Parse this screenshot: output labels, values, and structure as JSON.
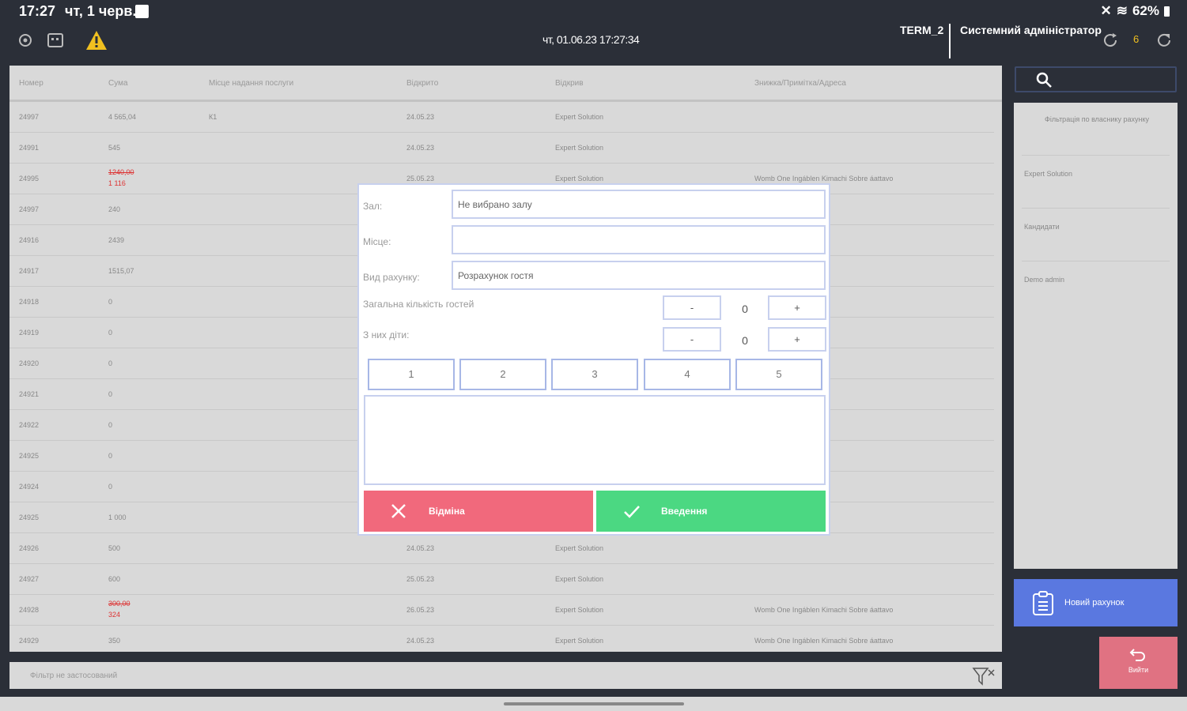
{
  "status_bar": {
    "time": "17:27",
    "date": "чт, 1 черв.",
    "battery": "62%"
  },
  "header": {
    "datetime": "чт, 01.06.23 17:27:34",
    "terminal": "TERM_2",
    "user": "Системний адміністратор",
    "notification_count": "6",
    "warning_color": "#f0c020"
  },
  "table": {
    "headers": [
      "Номер",
      "Сума",
      "Місце надання послуги",
      "Відкрито",
      "Відкрив",
      "Знижка/Примітка/Адреса"
    ],
    "rows": [
      {
        "num": "24997",
        "sum": "4 565,04",
        "sum2": "",
        "place": "К1",
        "opened": "24.05.23",
        "by": "Expert Solution",
        "note": ""
      },
      {
        "num": "24991",
        "sum": "545",
        "sum2": "",
        "place": "",
        "opened": "24.05.23",
        "by": "Expert Solution",
        "note": ""
      },
      {
        "num": "24995",
        "sum": "1240,00",
        "sum2": "1 116",
        "place": "",
        "opened": "25.05.23",
        "by": "Expert Solution",
        "note": "Womb One Ingáblen Kimachi Sobre áattavo"
      },
      {
        "num": "24997",
        "sum": "240",
        "sum2": "",
        "place": "",
        "opened": "",
        "by": "",
        "note": ""
      },
      {
        "num": "24916",
        "sum": "2439",
        "sum2": "",
        "place": "",
        "opened": "",
        "by": "",
        "note": ""
      },
      {
        "num": "24917",
        "sum": "1515,07",
        "sum2": "",
        "place": "",
        "opened": "",
        "by": "",
        "note": ""
      },
      {
        "num": "24918",
        "sum": "0",
        "sum2": "",
        "place": "",
        "opened": "",
        "by": "",
        "note": ""
      },
      {
        "num": "24919",
        "sum": "0",
        "sum2": "",
        "place": "",
        "opened": "",
        "by": "",
        "note": ""
      },
      {
        "num": "24920",
        "sum": "0",
        "sum2": "",
        "place": "",
        "opened": "",
        "by": "",
        "note": ""
      },
      {
        "num": "24921",
        "sum": "0",
        "sum2": "",
        "place": "",
        "opened": "",
        "by": "",
        "note": ""
      },
      {
        "num": "24922",
        "sum": "0",
        "sum2": "",
        "place": "",
        "opened": "",
        "by": "",
        "note": ""
      },
      {
        "num": "24925",
        "sum": "0",
        "sum2": "",
        "place": "",
        "opened": "",
        "by": "",
        "note": ""
      },
      {
        "num": "24924",
        "sum": "0",
        "sum2": "",
        "place": "",
        "opened": "",
        "by": "",
        "note": ""
      },
      {
        "num": "24925",
        "sum": "1 000",
        "sum2": "",
        "place": "",
        "opened": "",
        "by": "",
        "note": ""
      },
      {
        "num": "24926",
        "sum": "500",
        "sum2": "",
        "place": "",
        "opened": "24.05.23",
        "by": "Expert Solution",
        "note": ""
      },
      {
        "num": "24927",
        "sum": "600",
        "sum2": "",
        "place": "",
        "opened": "25.05.23",
        "by": "Expert Solution",
        "note": ""
      },
      {
        "num": "24928",
        "sum": "300,00",
        "sum2": "324",
        "place": "",
        "opened": "26.05.23",
        "by": "Expert Solution",
        "note": "Womb One Ingáblen Kimachi Sobre áattavo"
      },
      {
        "num": "24929",
        "sum": "350",
        "sum2": "",
        "place": "",
        "opened": "24.05.23",
        "by": "Expert Solution",
        "note": "Womb One Ingáblen Kimachi Sobre áattavo"
      }
    ]
  },
  "filter": {
    "label": "Фільтр не застосований"
  },
  "side_panel": {
    "items": [
      "Фільтрація по власнику рахунку",
      "Expert Solution",
      "Кандидати",
      "Demo admin"
    ]
  },
  "buttons": {
    "new_order": "Новий рахунок",
    "exit": "Вийти"
  },
  "dialog": {
    "hall_label": "Зал:",
    "hall_value": "Не вибрано залу",
    "place_label": "Місце:",
    "place_value": "",
    "order_type_label": "Вид рахунку:",
    "order_type_value": "Розрахунок гостя",
    "guests_label": "Загальна кількість гостей",
    "guests_value": "0",
    "children_label": "З них діти:",
    "children_value": "0",
    "minus": "-",
    "plus": "+",
    "quick_numbers": [
      "1",
      "2",
      "3",
      "4",
      "5"
    ],
    "cancel": "Відміна",
    "confirm": "Введення"
  }
}
